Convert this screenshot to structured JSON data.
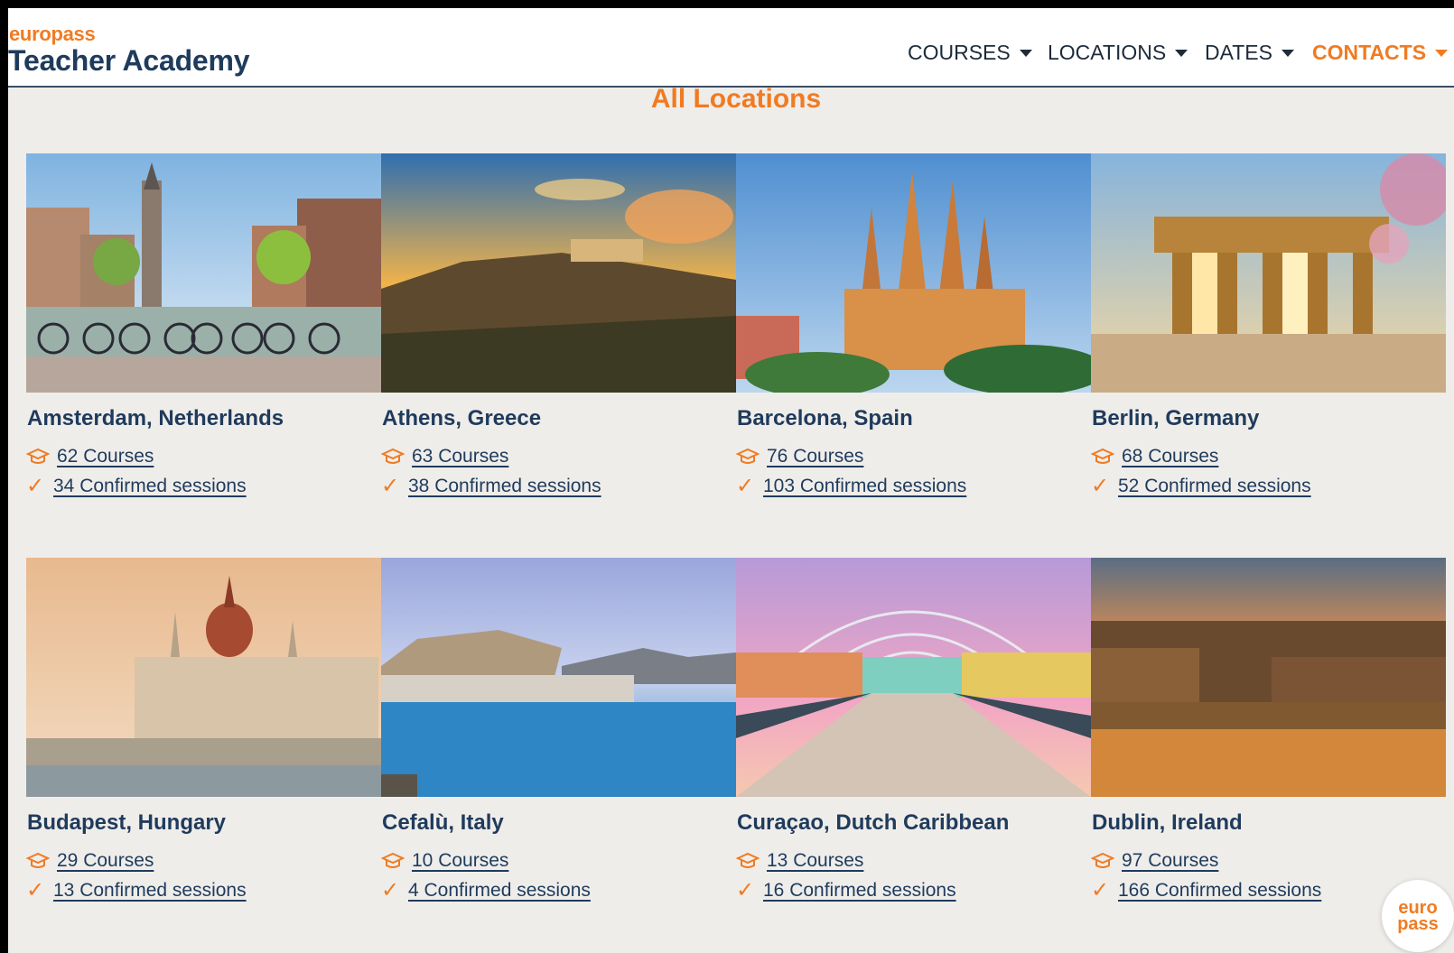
{
  "brand": {
    "top": "europass",
    "main": "Teacher Academy"
  },
  "nav": [
    {
      "label": "COURSES"
    },
    {
      "label": "LOCATIONS"
    },
    {
      "label": "DATES"
    },
    {
      "label": "CONTACTS"
    }
  ],
  "page_title": "All Locations",
  "locations": [
    {
      "name": "Amsterdam, Netherlands",
      "courses": "62 Courses",
      "sessions": "34 Confirmed sessions",
      "photo_icon": "canal-bicycles-photo"
    },
    {
      "name": "Athens, Greece",
      "courses": "63 Courses",
      "sessions": "38 Confirmed sessions",
      "photo_icon": "acropolis-sunset-photo"
    },
    {
      "name": "Barcelona, Spain",
      "courses": "76 Courses",
      "sessions": "103 Confirmed sessions",
      "photo_icon": "sagrada-familia-photo"
    },
    {
      "name": "Berlin, Germany",
      "courses": "68 Courses",
      "sessions": "52 Confirmed sessions",
      "photo_icon": "brandenburg-gate-photo"
    },
    {
      "name": "Budapest, Hungary",
      "courses": "29 Courses",
      "sessions": "13 Confirmed sessions",
      "photo_icon": "parliament-photo"
    },
    {
      "name": "Cefalù, Italy",
      "courses": "10 Courses",
      "sessions": "4 Confirmed sessions",
      "photo_icon": "coastal-town-photo"
    },
    {
      "name": "Curaçao, Dutch Caribbean",
      "courses": "13 Courses",
      "sessions": "16 Confirmed sessions",
      "photo_icon": "pontoon-bridge-photo"
    },
    {
      "name": "Dublin, Ireland",
      "courses": "97 Courses",
      "sessions": "166 Confirmed sessions",
      "photo_icon": "river-sunset-photo"
    }
  ],
  "badge": {
    "line1": "euro",
    "line2": "pass"
  },
  "colors": {
    "accent": "#f07b22",
    "navy": "#1f3b5c",
    "background": "#efedea"
  }
}
